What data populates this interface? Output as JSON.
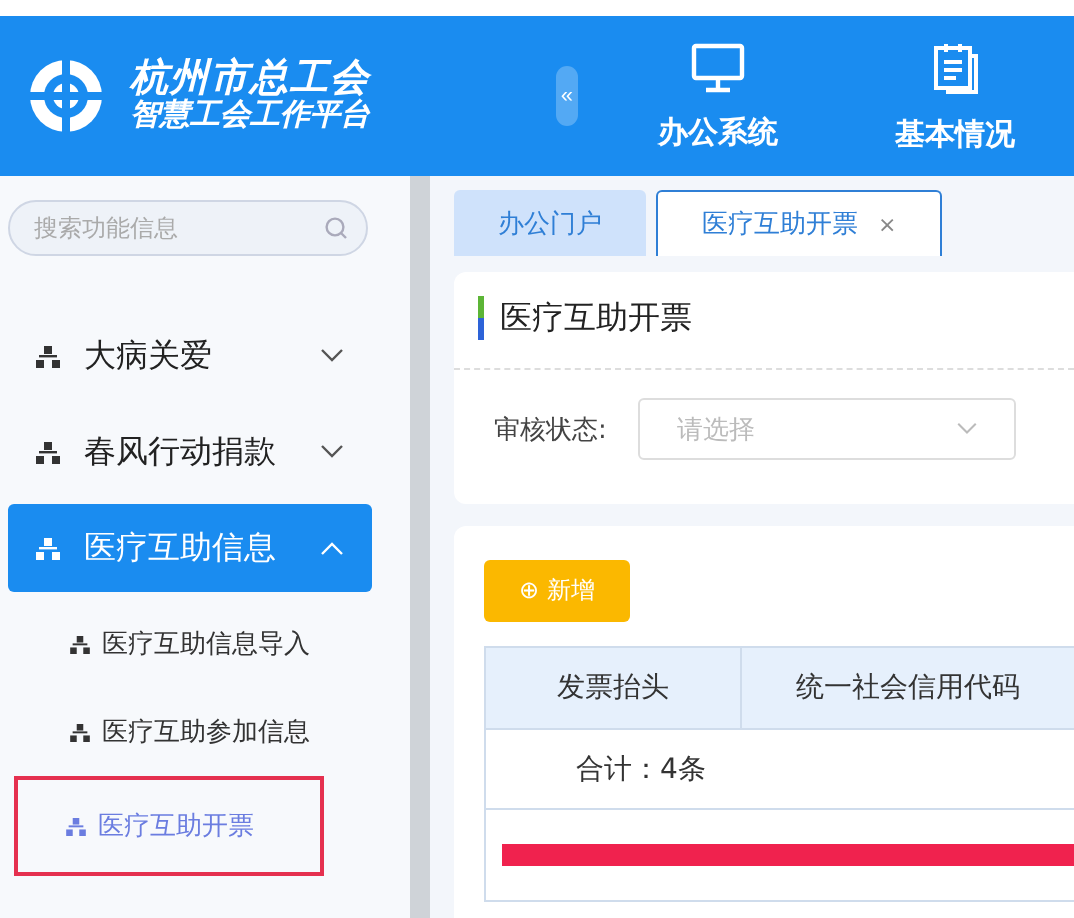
{
  "header": {
    "logo_line1": "杭州市总工会",
    "logo_line2": "智慧工会工作平台",
    "collapse": "«",
    "nav": [
      {
        "label": "办公系统"
      },
      {
        "label": "基本情况"
      }
    ]
  },
  "sidebar": {
    "search": {
      "placeholder": "搜索功能信息"
    },
    "menu": [
      {
        "label": "大病关爱",
        "expanded": false,
        "selected": false
      },
      {
        "label": "春风行动捐款",
        "expanded": false,
        "selected": false
      },
      {
        "label": "医疗互助信息",
        "expanded": true,
        "selected": true,
        "children": [
          {
            "label": "医疗互助信息导入",
            "selected": false,
            "highlighted": false
          },
          {
            "label": "医疗互助参加信息",
            "selected": false,
            "highlighted": false
          },
          {
            "label": "医疗互助开票",
            "selected": true,
            "highlighted": true
          }
        ]
      }
    ]
  },
  "tabs": [
    {
      "label": "办公门户",
      "selected": false
    },
    {
      "label": "医疗互助开票",
      "selected": true,
      "close": "×"
    }
  ],
  "page_title": "医疗互助开票",
  "filter": {
    "label": "审核状态:",
    "placeholder": "请选择"
  },
  "add_button": {
    "icon": "⊕",
    "label": "新增"
  },
  "table": {
    "columns": [
      "发票抬头",
      "统一社会信用代码"
    ],
    "summary": "合计：4条",
    "rows": [
      {
        "redacted": true
      }
    ]
  }
}
